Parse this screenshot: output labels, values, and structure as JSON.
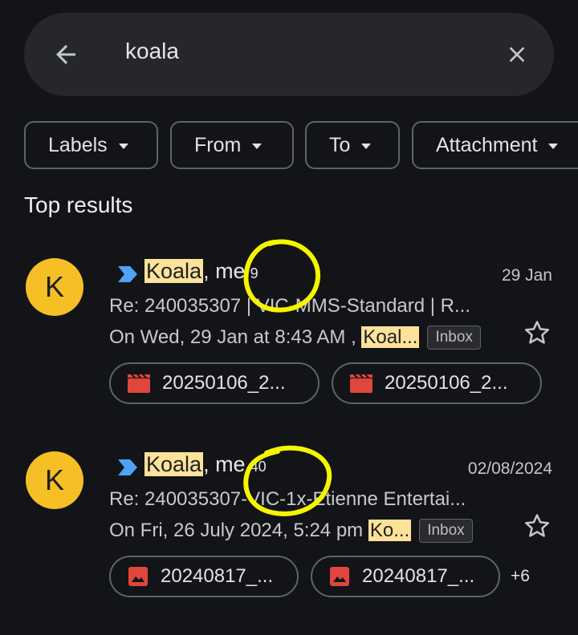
{
  "search": {
    "query": "koala"
  },
  "filters": [
    {
      "label": "Labels"
    },
    {
      "label": "From"
    },
    {
      "label": "To"
    },
    {
      "label": "Attachment"
    }
  ],
  "section_title": "Top results",
  "colors": {
    "background": "#131417",
    "avatar": "#f6bf26",
    "highlight": "#fde29a",
    "importance": "#4fa3f7",
    "annotation": "#f5f500"
  },
  "results": [
    {
      "avatar_letter": "K",
      "sender_highlight": "Koala",
      "sender_rest": ", me",
      "count": "9",
      "date": "29 Jan",
      "subject": "Re: 240035307 | VIC-MMS-Standard | R...",
      "snippet_prefix": "On Wed, 29 Jan at 8:43 AM ,",
      "snippet_highlight": "Koal...",
      "label": "Inbox",
      "attachments": [
        {
          "name": "20250106_2...",
          "icon": "video-icon"
        },
        {
          "name": "20250106_2...",
          "icon": "video-icon"
        }
      ]
    },
    {
      "avatar_letter": "K",
      "sender_highlight": "Koala",
      "sender_rest": ", me",
      "count": "40",
      "date": "02/08/2024",
      "subject": "Re: 240035307-VIC-1x-Etienne Entertai...",
      "snippet_prefix": "On Fri, 26 July 2024, 5:24 pm",
      "snippet_highlight": "Ko...",
      "label": "Inbox",
      "attachments": [
        {
          "name": "20240817_...",
          "icon": "image-icon"
        },
        {
          "name": "20240817_...",
          "icon": "image-icon"
        }
      ],
      "more_attachments": "+6"
    }
  ]
}
